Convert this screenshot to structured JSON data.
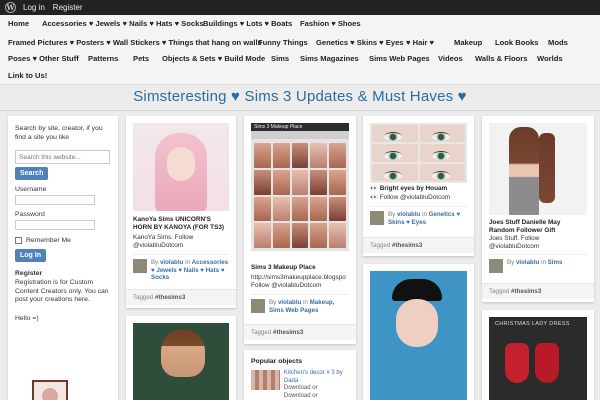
{
  "admin_bar": {
    "login": "Log in",
    "register": "Register"
  },
  "nav": {
    "rows": [
      [
        "Home",
        "Accessories ♥ Jewels ♥ Nails ♥ Hats ♥ Socks",
        "Buildings ♥ Lots ♥ Boats",
        "Fashion ♥ Shoes"
      ],
      [
        "Framed Pictures ♥ Posters ♥ Wall Stickers ♥ Things that hang on walls",
        "Funny Things",
        "Genetics ♥ Skins ♥ Eyes",
        "♥ Hair ♥",
        "Makeup",
        "Look Books",
        "Mods"
      ],
      [
        "Poses ♥ Other Stuff",
        "Patterns",
        "Pets",
        "Objects & Sets ♥ Build Mode",
        "Sims",
        "Sims Magazines",
        "Sims Web Pages",
        "Videos",
        "Walls & Floors",
        "Worlds"
      ],
      [
        "Link to Us!"
      ]
    ]
  },
  "site_title": "Simsteresting ♥ Sims 3 Updates & Must Haves ♥",
  "sidebar": {
    "intro": "Search by site, creator, if you find a site you like",
    "search_placeholder": "Search this website...",
    "search_button": "Search",
    "username_label": "Username",
    "password_label": "Password",
    "remember_label": "Remember Me",
    "login_button": "Log In",
    "register_heading": "Register",
    "register_text": "Registration is for Custom Content Creators only. You can post your creations here.",
    "hello": "Hello =)"
  },
  "cards": [
    {
      "title": "KanoYa Sims UNICORN'S HORN BY KANOYA (FOR TS3)",
      "desc": "KanoYa Sims. Follow @violabluDotcom",
      "by_prefix": "By ",
      "author": "violablu",
      "in_word": " in ",
      "category": "Accessories ♥ Jewels ♥ Nails ♥ Hats ♥ Socks",
      "tagged": "Tagged ",
      "tag": "#thesims3"
    },
    {
      "img_header": "Sims 3 Makeup Place",
      "title": "Sims 3 Makeup Place",
      "desc": "http://sims3makeupplace.blogspo Follow @violabluDotcom",
      "by_prefix": "By ",
      "author": "violablu",
      "in_word": " in ",
      "category": "Makeup, Sims Web Pages",
      "tagged": "Tagged ",
      "tag": "#thesims3"
    },
    {
      "title": "👀 Bright eyes by Houam",
      "desc": "👀 Follow @violabluDotcom",
      "by_prefix": "By ",
      "author": "violablu",
      "in_word": " in ",
      "category": "Genetics ♥ Skins ♥ Eyes",
      "tagged": "Tagged ",
      "tag": "#thesims3"
    },
    {
      "title": "Joes Stuff Danielle May Random Follower Gift",
      "desc": "Joes Stuff. Follow @violabluDotcom",
      "by_prefix": "By ",
      "author": "violablu",
      "in_word": " in ",
      "category": "Sims",
      "tagged": "Tagged ",
      "tag": "#thesims3"
    }
  ],
  "card_redgirls_label": "CHRISTMAS LADY DRESS",
  "popular": {
    "heading": "Popular objects",
    "item_link": "Kitchen's decor # 3 by Dada",
    "item_line2": "Download or",
    "item_line3": "Download or"
  }
}
